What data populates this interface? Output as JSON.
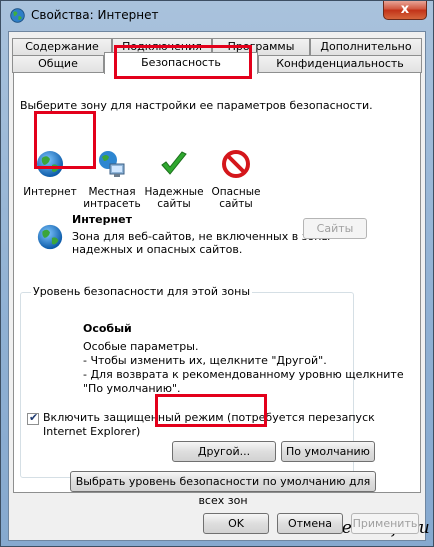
{
  "window": {
    "title": "Свойства: Интернет",
    "close_label": "x"
  },
  "tabs": {
    "row1": [
      "Содержание",
      "Подключения",
      "Программы",
      "Дополнительно"
    ],
    "row2": [
      "Общие",
      "Безопасность",
      "Конфиденциальность"
    ],
    "active": "Безопасность"
  },
  "security": {
    "zone_prompt": "Выберите зону для настройки ее параметров безопасности.",
    "zones": [
      {
        "line1": "Интернет",
        "line2": "",
        "icon": "globe-icon"
      },
      {
        "line1": "Местная",
        "line2": "интрасеть",
        "icon": "intranet-icon"
      },
      {
        "line1": "Надежные",
        "line2": "сайты",
        "icon": "checkmark-icon"
      },
      {
        "line1": "Опасные",
        "line2": "сайты",
        "icon": "restricted-icon"
      }
    ],
    "selected_zone": {
      "name": "Интернет",
      "desc1": "Зона для веб-сайтов, не включенных в зоны",
      "desc2": "надежных и опасных сайтов."
    },
    "sites_button": "Сайты",
    "level_group_title": "Уровень безопасности для этой зоны",
    "level": {
      "name": "Особый",
      "line1": "Особые параметры.",
      "line2": "- Чтобы изменить их, щелкните \"Другой\".",
      "line3": "- Для возврата к рекомендованному уровню щелкните",
      "line4": "\"По умолчанию\"."
    },
    "protected_mode": {
      "label1": "Включить защищенный режим (потребуется перезапуск",
      "label2": "Internet Explorer)",
      "checked": true
    },
    "other_button": "Другой...",
    "default_button": "По умолчанию",
    "reset_all_button": "Выбрать уровень безопасности по умолчанию для всех зон"
  },
  "watermark": "AlexZsoft.ru",
  "footer": {
    "ok": "OK",
    "cancel": "Отмена",
    "apply": "Применить"
  },
  "colors": {
    "highlight": "#e3001b",
    "panel": "#ffffff",
    "frame": "#a9c2dc"
  }
}
